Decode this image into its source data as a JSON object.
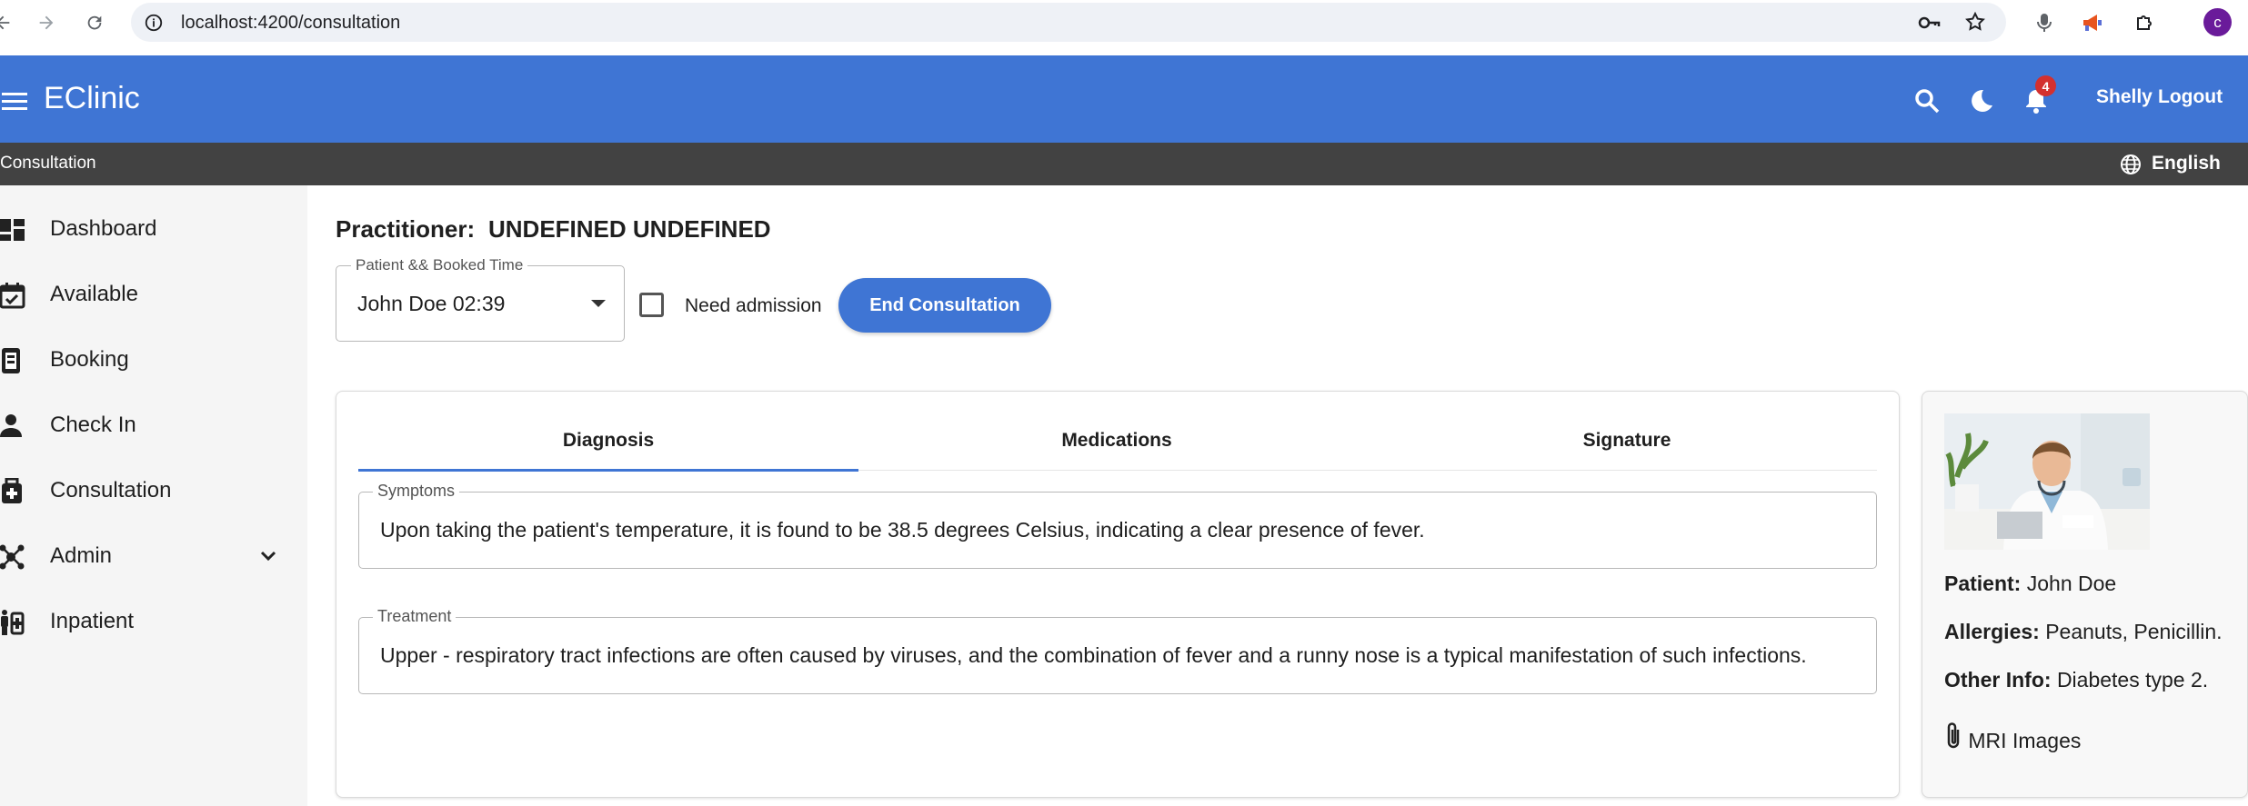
{
  "browser": {
    "url": "localhost:4200/consultation",
    "profile_initial": "c"
  },
  "app": {
    "title": "EClinic",
    "notification_count": "4",
    "user": "Shelly",
    "logout_label": "Logout",
    "breadcrumb": "Consultation",
    "language": "English",
    "primary_color": "#3f75d4"
  },
  "sidebar": {
    "items": [
      {
        "label": "Dashboard",
        "icon": "dashboard-icon"
      },
      {
        "label": "Available",
        "icon": "calendar-check-icon"
      },
      {
        "label": "Booking",
        "icon": "booking-icon"
      },
      {
        "label": "Check In",
        "icon": "person-icon"
      },
      {
        "label": "Consultation",
        "icon": "medical-bag-icon"
      },
      {
        "label": "Admin",
        "icon": "hub-icon"
      },
      {
        "label": "Inpatient",
        "icon": "inpatient-icon"
      }
    ]
  },
  "main": {
    "practitioner_label": "Practitioner:",
    "practitioner_name": "UNDEFINED UNDEFINED",
    "patient_select": {
      "label": "Patient && Booked Time",
      "value": "John Doe 02:39"
    },
    "need_admission_label": "Need admission",
    "end_button": "End Consultation",
    "tabs": [
      "Diagnosis",
      "Medications",
      "Signature"
    ],
    "symptoms": {
      "label": "Symptoms",
      "value": "Upon taking the patient's temperature, it is found to be 38.5 degrees Celsius, indicating a clear presence of fever."
    },
    "treatment": {
      "label": "Treatment",
      "value": "Upper - respiratory tract infections are often caused by viruses, and the combination of fever and a runny nose is a typical manifestation of such infections."
    }
  },
  "patient": {
    "patient_label": "Patient:",
    "patient_name": "John Doe",
    "allergies_label": "Allergies:",
    "allergies": "Peanuts, Penicillin.",
    "other_label": "Other Info:",
    "other": "Diabetes type 2.",
    "attachment": "MRI Images"
  }
}
